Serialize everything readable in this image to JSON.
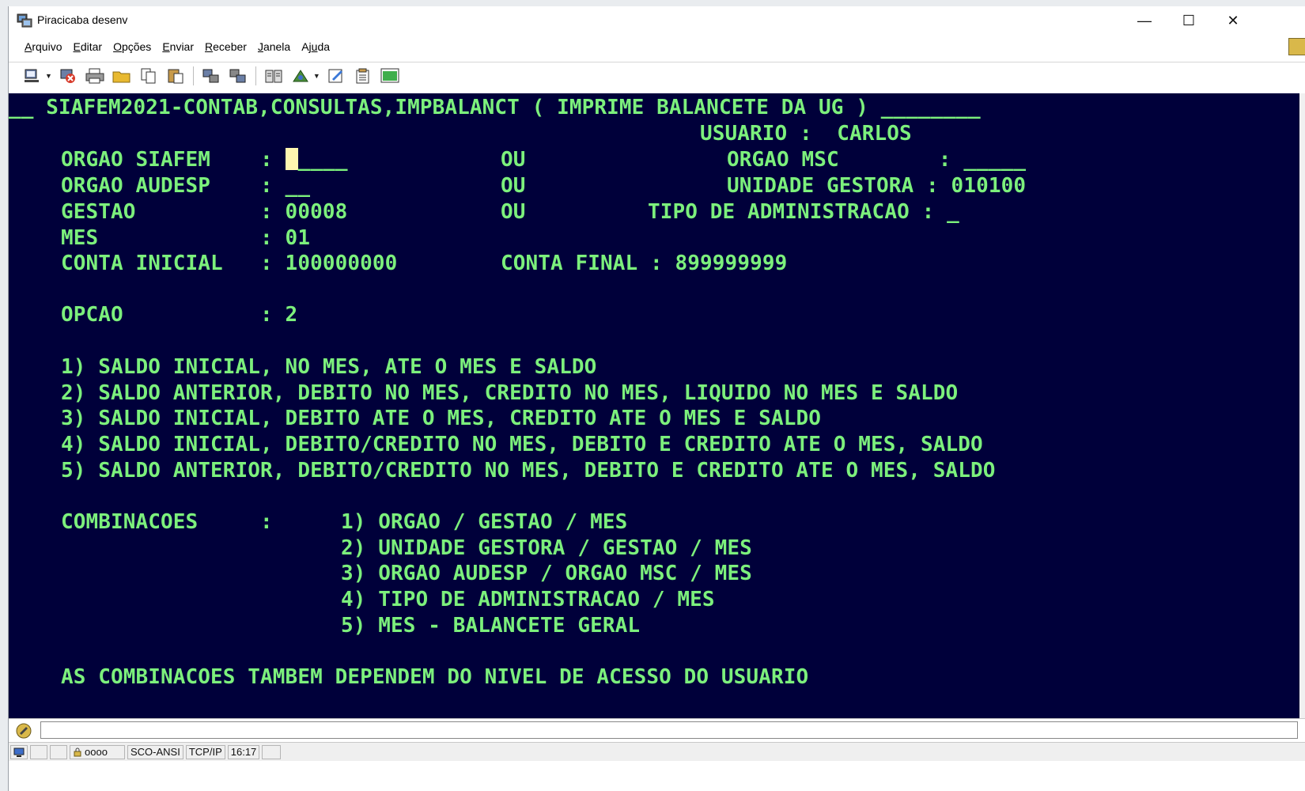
{
  "window": {
    "title": "Piracicaba desenv",
    "minimize": "—",
    "maximize": "☐",
    "close": "✕"
  },
  "menu": [
    {
      "prefix": "",
      "key": "A",
      "rest": "rquivo"
    },
    {
      "prefix": "",
      "key": "E",
      "rest": "ditar"
    },
    {
      "prefix": "",
      "key": "O",
      "rest": "pções"
    },
    {
      "prefix": "",
      "key": "E",
      "rest": "nviar"
    },
    {
      "prefix": "",
      "key": "R",
      "rest": "eceber"
    },
    {
      "prefix": "",
      "key": "J",
      "rest": "anela"
    },
    {
      "prefix": "Aj",
      "key": "u",
      "rest": "da"
    }
  ],
  "terminal": {
    "header": "__ SIAFEM2021-CONTAB,CONSULTAS,IMPBALANCT ( IMPRIME BALANCETE DA UG ) ________",
    "usuario": "USUARIO :  CARLOS",
    "orgao_siafem_label": "ORGAO SIAFEM    : ",
    "orgao_siafem_blank": "____",
    "ou": "OU",
    "orgao_msc": "ORGAO MSC        : _____",
    "orgao_audesp": "ORGAO AUDESP    : __",
    "unidade_gestora": "UNIDADE GESTORA : 010100",
    "gestao": "GESTAO          : 00008",
    "tipo_admin": "TIPO DE ADMINISTRACAO : _",
    "mes": "MES             : 01",
    "conta_inicial": "CONTA INICIAL   : 100000000",
    "conta_final": "CONTA FINAL : 899999999",
    "opcao": "OPCAO           : 2",
    "options": [
      "1) SALDO INICIAL, NO MES, ATE O MES E SALDO",
      "2) SALDO ANTERIOR, DEBITO NO MES, CREDITO NO MES, LIQUIDO NO MES E SALDO",
      "3) SALDO INICIAL, DEBITO ATE O MES, CREDITO ATE O MES E SALDO",
      "4) SALDO INICIAL, DEBITO/CREDITO NO MES, DEBITO E CREDITO ATE O MES, SALDO",
      "5) SALDO ANTERIOR, DEBITO/CREDITO NO MES, DEBITO E CREDITO ATE O MES, SALDO"
    ],
    "combinacoes_label": "COMBINACOES     :",
    "combinacoes": [
      "1) ORGAO / GESTAO / MES",
      "2) UNIDADE GESTORA / GESTAO / MES",
      "3) ORGAO AUDESP / ORGAO MSC / MES",
      "4) TIPO DE ADMINISTRACAO / MES",
      "5) MES - BALANCETE GERAL"
    ],
    "footer": "AS COMBINACOES TAMBEM DEPENDEM DO NIVEL DE ACESSO DO USUARIO"
  },
  "statusbar": {
    "session": "oooo",
    "emulation": "SCO-ANSI",
    "protocol": "TCP/IP",
    "time": "16:17"
  },
  "colors": {
    "terminal_bg": "#00003a",
    "terminal_fg": "#7cf07c",
    "cursor": "#fff6b0"
  }
}
